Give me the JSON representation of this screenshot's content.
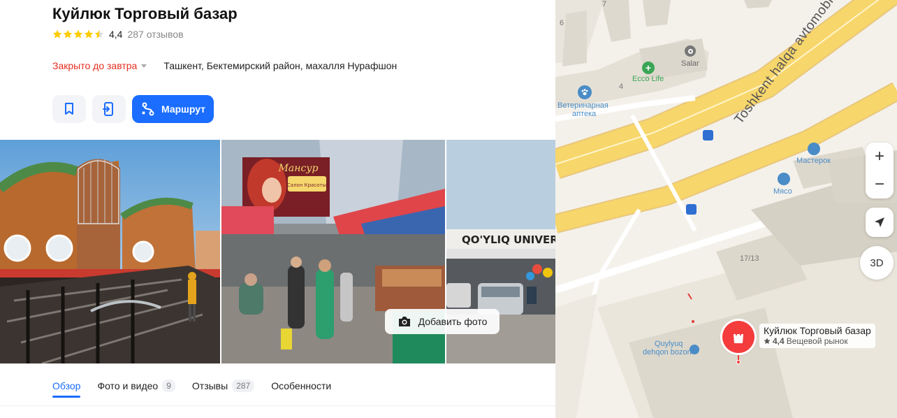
{
  "place": {
    "title": "Куйлюк Торговый базар",
    "rating": "4,4",
    "rating_stars": 4.4,
    "reviews": "287 отзывов",
    "status": "Закрыто до завтра",
    "address": "Ташкент, Бектемирский район, махалля Нурафшон"
  },
  "actions": {
    "bookmark_icon": "bookmark-icon",
    "phone_icon": "phone-send-icon",
    "route_label": "Маршрут"
  },
  "photos": {
    "add_photo_label": "Добавить фото",
    "photo2_sign": "Мансур",
    "photo2_sign_sub": "Салон Красоты",
    "photo3_sign": "QO'YLIQ UNIVERSAL"
  },
  "tabs": [
    {
      "label": "Обзор",
      "badge": ""
    },
    {
      "label": "Фото и видео",
      "badge": "9"
    },
    {
      "label": "Отзывы",
      "badge": "287"
    },
    {
      "label": "Особенности",
      "badge": ""
    }
  ],
  "map": {
    "road_label": "Toshkent halqa avtomobil",
    "labels": {
      "n7": "7",
      "n6": "6",
      "n4": "4",
      "salar": "Salar",
      "ecco": "Ecco Life",
      "vet1": "Ветеринарная",
      "vet2": "аптека",
      "masterok": "Мастерок",
      "myaso": "Мясо",
      "bldg": "17/13",
      "qb1": "Quylyuq",
      "qb2": "dehqon bozori"
    },
    "zoom_in": "+",
    "zoom_out": "−",
    "btn_3d": "3D",
    "pin_title": "Куйлюк Торговый базар",
    "pin_rating": "4,4",
    "pin_category": "Вещевой рынок",
    "colors": {
      "road": "#f7d66b",
      "pin": "#f43c3c",
      "accent": "#1a6dff"
    }
  }
}
